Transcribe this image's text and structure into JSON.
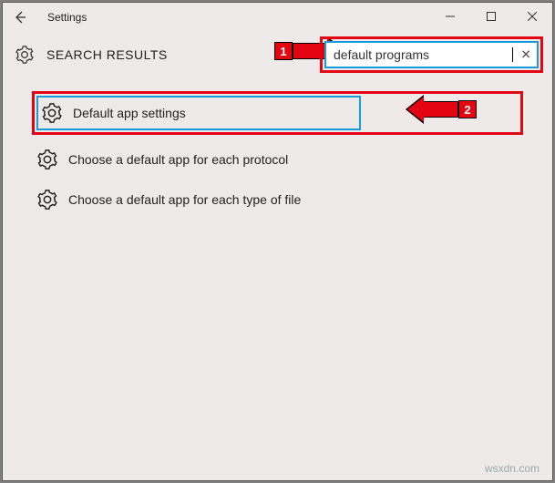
{
  "window": {
    "title": "Settings"
  },
  "header": {
    "title": "SEARCH RESULTS"
  },
  "search": {
    "value": "default programs",
    "clear_glyph": "✕"
  },
  "results": [
    {
      "label": "Default app settings",
      "highlighted": true
    },
    {
      "label": "Choose a default app for each protocol",
      "highlighted": false
    },
    {
      "label": "Choose a default app for each type of file",
      "highlighted": false
    }
  ],
  "annotations": {
    "num1": "1",
    "num2": "2"
  },
  "watermark": "wsxdn.com"
}
